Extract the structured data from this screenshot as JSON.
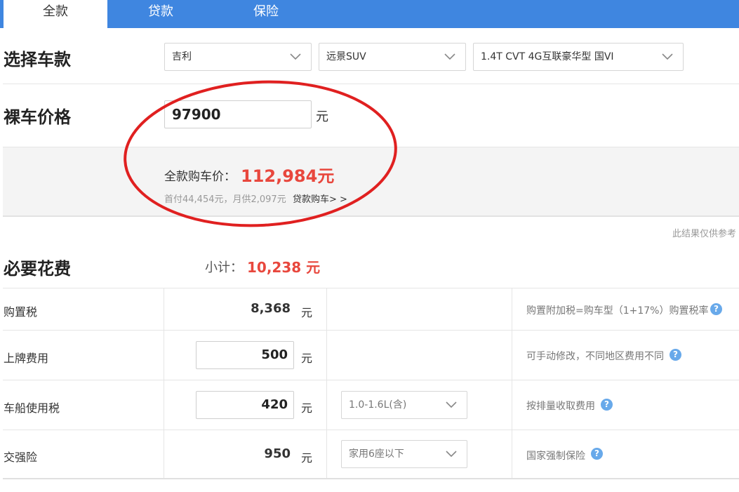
{
  "tabs": [
    {
      "label": "全款",
      "active": true
    },
    {
      "label": "贷款",
      "active": false
    },
    {
      "label": "保险",
      "active": false
    }
  ],
  "select_model": {
    "title": "选择车款",
    "brand": "吉利",
    "series": "远景SUV",
    "trim": "1.4T CVT 4G互联豪华型 国VI"
  },
  "bare_price": {
    "title": "裸车价格",
    "value": "97900",
    "unit": "元"
  },
  "result": {
    "total_label": "全款购车价：",
    "total_value": "112,984元",
    "sub_info": "首付44,454元，月供2,097元",
    "loan_link": "贷款购车> >",
    "disclaimer": "此结果仅供参考"
  },
  "required_costs": {
    "title": "必要花费",
    "subtotal_label": "小计：",
    "subtotal_value": "10,238 元",
    "rows": [
      {
        "label": "购置税",
        "value": "8,368",
        "unit": "元",
        "note": "购置附加税=购车型（1+17%）购置税率",
        "help": "?"
      },
      {
        "label": "上牌费用",
        "value": "500",
        "unit": "元",
        "note": "可手动修改，不同地区费用不同",
        "help": "?"
      },
      {
        "label": "车船使用税",
        "value": "420",
        "unit": "元",
        "select": "1.0-1.6L(含)",
        "note": "按排量收取费用",
        "help": "?"
      },
      {
        "label": "交强险",
        "value": "950",
        "unit": "元",
        "select": "家用6座以下",
        "note": "国家强制保险",
        "help": "?"
      }
    ]
  },
  "colors": {
    "tab_bar": "#3f86e0",
    "price_red": "#e8473d",
    "annotation_circle": "#e02020",
    "help_icon": "#68a9ea"
  }
}
